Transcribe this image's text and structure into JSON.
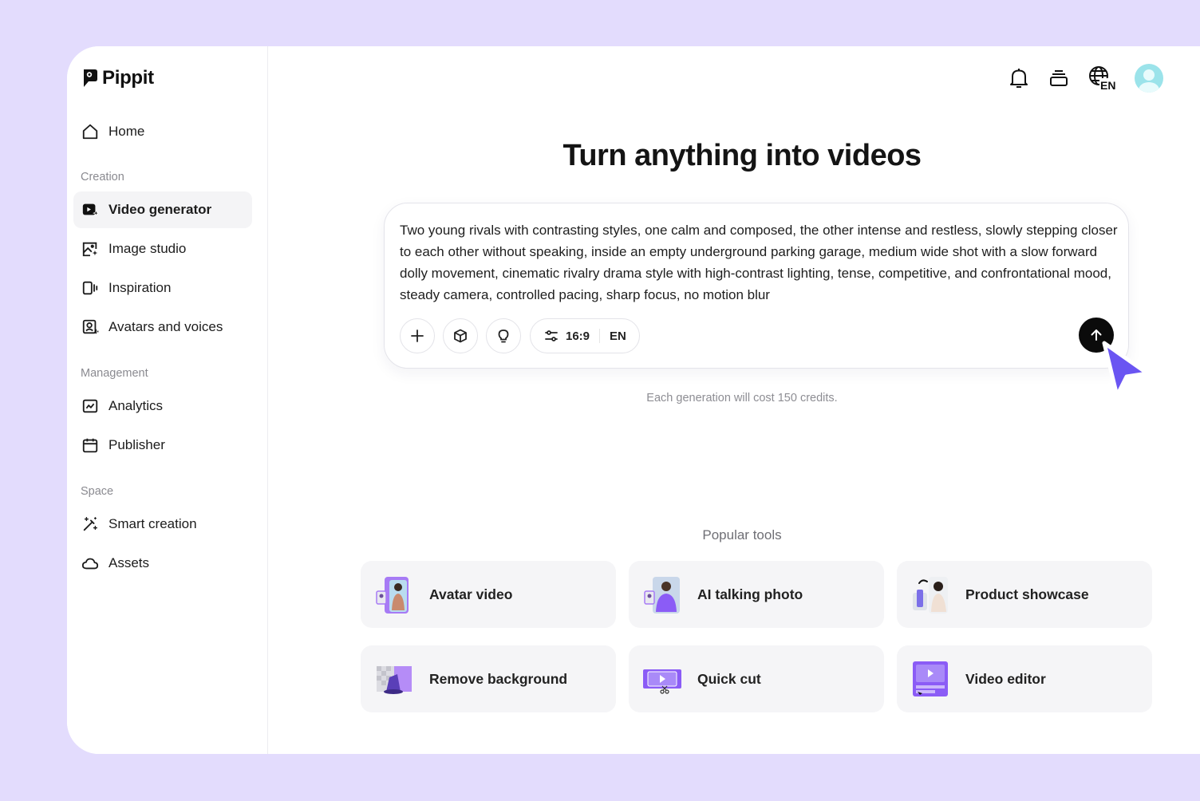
{
  "brand": {
    "name": "Pippit"
  },
  "sidebar": {
    "home_label": "Home",
    "sections": {
      "creation": "Creation",
      "management": "Management",
      "space": "Space"
    },
    "items": {
      "video_generator": "Video generator",
      "image_studio": "Image studio",
      "inspiration": "Inspiration",
      "avatars_voices": "Avatars and voices",
      "analytics": "Analytics",
      "publisher": "Publisher",
      "smart_creation": "Smart creation",
      "assets": "Assets"
    },
    "active_item": "Video generator"
  },
  "topbar": {
    "icons": [
      "bell-icon",
      "stack-icon",
      "globe-language-icon",
      "user-avatar"
    ],
    "language": "EN"
  },
  "main": {
    "headline": "Turn anything into videos",
    "prompt": {
      "text": "Two young rivals with contrasting styles, one calm and composed, the other intense and restless, slowly stepping closer to each other without speaking, inside an empty underground parking garage, medium wide shot with a slow forward dolly movement, cinematic rivalry drama style with high-contrast lighting, tense, competitive, and confrontational mood, steady camera, controlled pacing, sharp focus, no motion blur",
      "aspect_ratio": "16:9",
      "language": "EN"
    },
    "credits_note": "Each generation will cost 150 credits.",
    "popular_tools_title": "Popular tools",
    "tools": [
      {
        "label": "Avatar video"
      },
      {
        "label": "AI talking photo"
      },
      {
        "label": "Product showcase"
      },
      {
        "label": "Remove background"
      },
      {
        "label": "Quick cut"
      },
      {
        "label": "Video editor"
      }
    ]
  },
  "colors": {
    "background": "#e3dcfd",
    "accent": "#8b5cf6",
    "cursor": "#6a55f2",
    "send_button": "#0b0b0b"
  }
}
